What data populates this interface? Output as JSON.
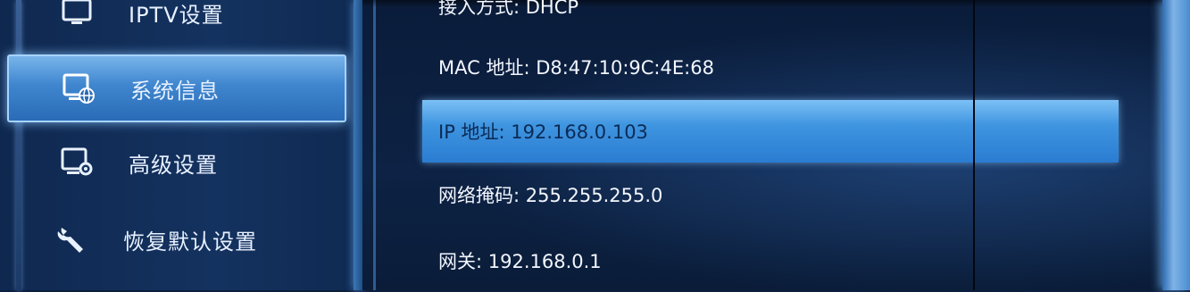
{
  "sidebar": {
    "items": [
      {
        "label": "IPTV设置",
        "icon": "tv-icon"
      },
      {
        "label": "系统信息",
        "icon": "monitor-globe-icon"
      },
      {
        "label": "高级设置",
        "icon": "monitor-gear-icon"
      },
      {
        "label": "恢复默认设置",
        "icon": "wrench-icon"
      }
    ],
    "active_index": 1
  },
  "info": {
    "rows": [
      {
        "text": "接入方式: DHCP"
      },
      {
        "text": "MAC 地址: D8:47:10:9C:4E:68"
      },
      {
        "text": "IP 地址: 192.168.0.103"
      },
      {
        "text": "网络掩码: 255.255.255.0"
      },
      {
        "text": "网关: 192.168.0.1"
      }
    ],
    "active_index": 2
  },
  "colors": {
    "accent": "#3f95e0",
    "background": "#0b1e3d"
  }
}
